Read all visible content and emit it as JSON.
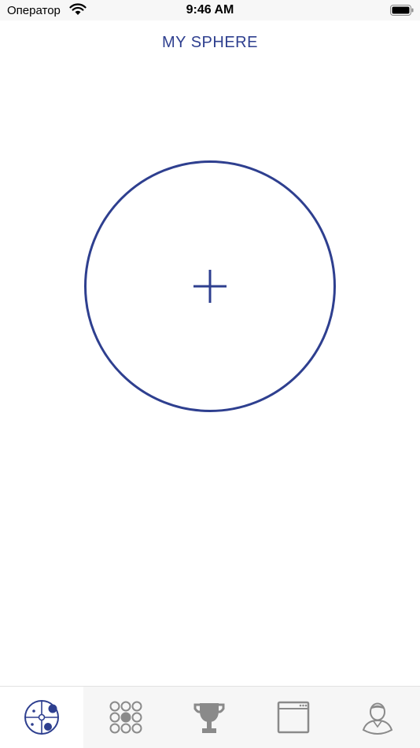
{
  "status_bar": {
    "carrier": "Оператор",
    "time": "9:46 AM",
    "icons": [
      "wifi-icon",
      "battery-icon"
    ]
  },
  "header": {
    "title": "MY SPHERE"
  },
  "main": {
    "add_button_icon": "plus-icon"
  },
  "tab_bar": {
    "active_index": 0,
    "tabs": [
      {
        "icon": "sphere-icon"
      },
      {
        "icon": "grid-dots-icon"
      },
      {
        "icon": "trophy-icon"
      },
      {
        "icon": "browser-window-icon"
      },
      {
        "icon": "profile-icon"
      }
    ]
  },
  "colors": {
    "accent": "#2e3f8f",
    "inactive_icon": "#8a8a8a",
    "tab_bar_bg": "#f6f6f6"
  }
}
